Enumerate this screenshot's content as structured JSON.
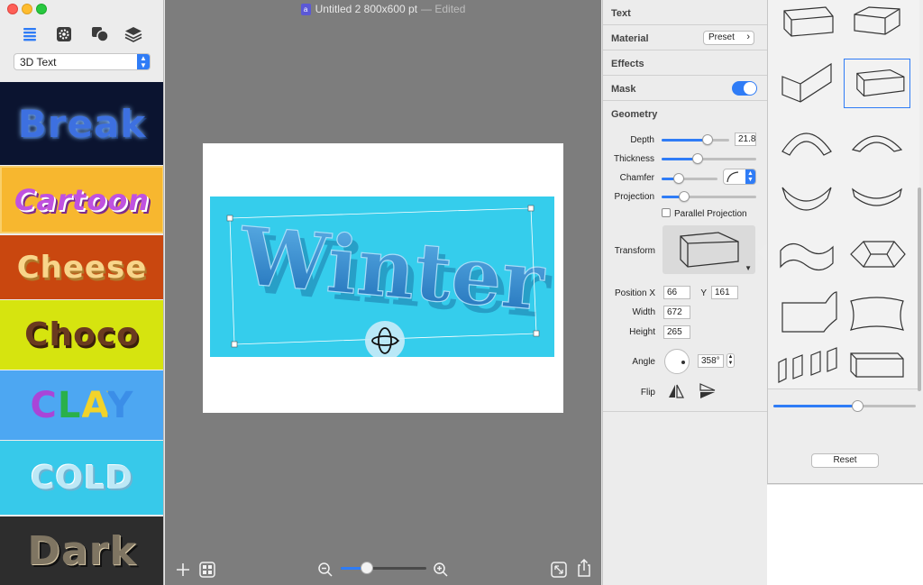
{
  "window": {
    "title": "Untitled 2 800x600 pt",
    "status": "— Edited",
    "doc_icon": "a"
  },
  "sidebar": {
    "tools": [
      "list-icon",
      "settings-gear-icon",
      "shapes-icon",
      "layers-icon"
    ],
    "style_select": "3D Text",
    "styles": [
      {
        "label": "Break",
        "bg": "#0b1430",
        "color": "#2c5fd1"
      },
      {
        "label": "Cartoon",
        "bg": "#f7b72f",
        "color": "#b23fd6"
      },
      {
        "label": "Cheese",
        "bg": "#c9470f",
        "color": "#f8d58a"
      },
      {
        "label": "Choco",
        "bg": "#d6e40f",
        "color": "#6a3a1f"
      },
      {
        "label": "CLAY",
        "bg": "#4da7f2",
        "color": "#a945d8"
      },
      {
        "label": "COLD",
        "bg": "#37c9ea",
        "color": "#bde8f6"
      },
      {
        "label": "Dark",
        "bg": "#2d2d2d",
        "color": "#8a7a62"
      }
    ]
  },
  "canvas": {
    "text": "Winter",
    "artboard_color": "#35cdec",
    "zoom_level": 0.3
  },
  "inspector": {
    "sections": [
      "Text",
      "Material",
      "Effects",
      "Mask",
      "Geometry"
    ],
    "preset_label": "Preset",
    "mask_enabled": true,
    "geometry": {
      "depth_label": "Depth",
      "depth_value": "21.8",
      "depth_level": 0.68,
      "thickness_label": "Thickness",
      "thickness_level": 0.38,
      "chamfer_label": "Chamfer",
      "chamfer_level": 0.3,
      "projection_label": "Projection",
      "projection_level": 0.24,
      "parallel_label": "Parallel Projection",
      "transform_label": "Transform",
      "posx_label": "Position X",
      "posx": "66",
      "posy_label": "Y",
      "posy": "161",
      "width_label": "Width",
      "width": "672",
      "height_label": "Height",
      "height": "265",
      "angle_label": "Angle",
      "angle": "358°",
      "flip_label": "Flip"
    }
  },
  "popover": {
    "reset_label": "Reset",
    "slider_level": 0.59
  }
}
